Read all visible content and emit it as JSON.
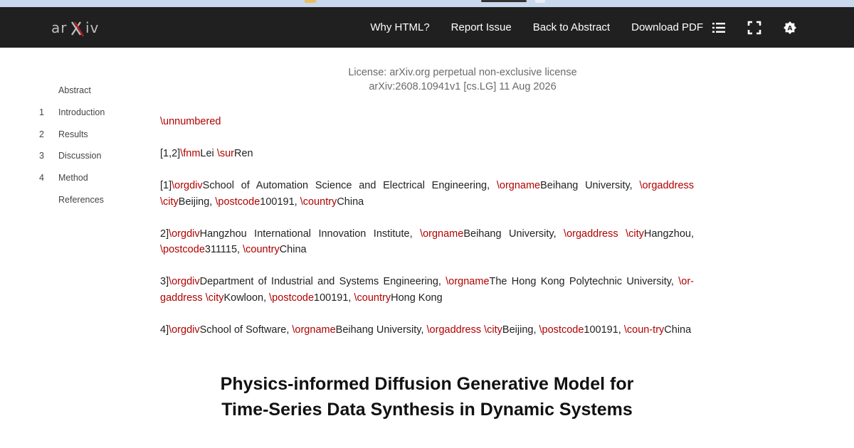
{
  "nav": {
    "logo_alt": "arXiv",
    "links": [
      "Why HTML?",
      "Report Issue",
      "Back to Abstract",
      "Download PDF"
    ],
    "icons": [
      "list-icon",
      "fullscreen-icon",
      "theme-toggle-icon"
    ]
  },
  "toc": {
    "items": [
      {
        "num": "",
        "label": "Abstract"
      },
      {
        "num": "1",
        "label": "Introduction"
      },
      {
        "num": "2",
        "label": "Results"
      },
      {
        "num": "3",
        "label": "Discussion"
      },
      {
        "num": "4",
        "label": "Method"
      },
      {
        "num": "",
        "label": "References"
      }
    ]
  },
  "license": {
    "line1": "License: arXiv.org perpetual non-exclusive license",
    "line2": "arXiv:2608.10941v1 [cs.LG] 11 Aug 2026"
  },
  "body": {
    "unnumbered": "\\unnumbered",
    "authors_line": {
      "p1": "[1,2]",
      "c1": "\\fnm",
      "p2": "Lei ",
      "c2": "\\sur",
      "p3": "Ren"
    },
    "aff1": {
      "p1": "[1]",
      "c1": "\\orgdiv",
      "p2": "School of Automation Science and Electrical Engineering, ",
      "c2": "\\orgname",
      "p3": "Beihang University, ",
      "c3": "\\orgaddress ",
      "c4": "\\city",
      "p4": "Beijing, ",
      "c5": "\\postcode",
      "p5": "100191, ",
      "c6": "\\country",
      "p6": "China"
    },
    "aff2": {
      "p1": "2]",
      "c1": "\\orgdiv",
      "p2": "Hangzhou International Innovation Institute, ",
      "c2": "\\orgname",
      "p3": "Beihang University, ",
      "c3": "\\orgaddress ",
      "c4": "\\city",
      "p4": "Hangzhou, ",
      "c5": "\\postcode",
      "p5": "311115, ",
      "c6": "\\country",
      "p6": "China"
    },
    "aff3": {
      "p1": "3]",
      "c1": "\\orgdiv",
      "p2": "Department of Industrial and Systems Engineering, ",
      "c2": "\\orgname",
      "p3": "The Hong Kong Polytechnic University, ",
      "c3": "\\or-gaddress ",
      "c4": "\\city",
      "p4": "Kowloon, ",
      "c5": "\\postcode",
      "p5": "100191, ",
      "c6": "\\country",
      "p6": "Hong Kong"
    },
    "aff4": {
      "p1": "4]",
      "c1": "\\orgdiv",
      "p2": "School of Software, ",
      "c2": "\\orgname",
      "p3": "Beihang University, ",
      "c3": "\\orgaddress ",
      "c4": "\\city",
      "p4": "Beijing, ",
      "c5": "\\postcode",
      "p5": "100191, ",
      "c6": "\\coun-try",
      "p6": "China"
    },
    "title_line1": "Physics-informed Diffusion Generative Model for",
    "title_line2": "Time-Series Data Synthesis in Dynamic Systems"
  },
  "colors": {
    "navbar": "#202020",
    "command": "#b00000",
    "logo_x": "#b31b1b"
  }
}
